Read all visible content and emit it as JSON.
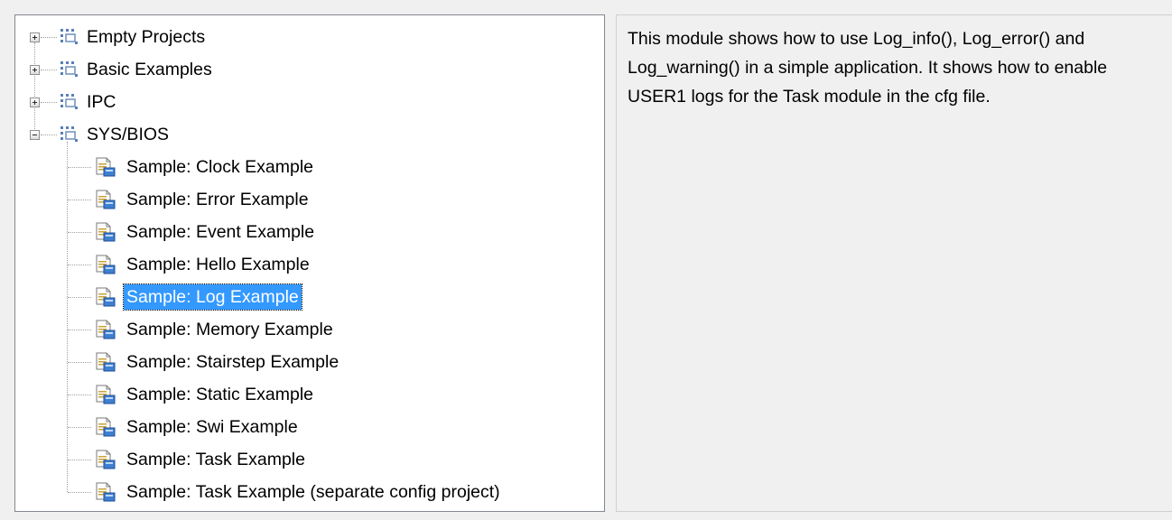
{
  "tree": {
    "root_items": [
      {
        "label": "Empty Projects",
        "expanded": false
      },
      {
        "label": "Basic Examples",
        "expanded": false
      },
      {
        "label": "IPC",
        "expanded": false
      },
      {
        "label": "SYS/BIOS",
        "expanded": true
      }
    ],
    "sysbios_children": [
      {
        "label": "Sample: Clock Example",
        "selected": false
      },
      {
        "label": "Sample: Error Example",
        "selected": false
      },
      {
        "label": "Sample: Event Example",
        "selected": false
      },
      {
        "label": "Sample: Hello Example",
        "selected": false
      },
      {
        "label": "Sample: Log Example",
        "selected": true
      },
      {
        "label": "Sample: Memory Example",
        "selected": false
      },
      {
        "label": "Sample: Stairstep Example",
        "selected": false
      },
      {
        "label": "Sample: Static Example",
        "selected": false
      },
      {
        "label": "Sample: Swi Example",
        "selected": false
      },
      {
        "label": "Sample: Task Example",
        "selected": false
      },
      {
        "label": "Sample: Task Example (separate config project)",
        "selected": false
      }
    ]
  },
  "description": {
    "text": "This module shows how to use Log_info(), Log_error() and Log_warning() in a simple application. It shows how to enable USER1 logs for the Task module in the cfg file."
  },
  "colors": {
    "selection": "#3399ff",
    "pane_border": "#828790",
    "background": "#f0f0f0"
  },
  "icons": {
    "folder": "project-folder-icon",
    "file": "example-project-icon",
    "expand": "expand-plus-icon",
    "collapse": "collapse-minus-icon"
  }
}
